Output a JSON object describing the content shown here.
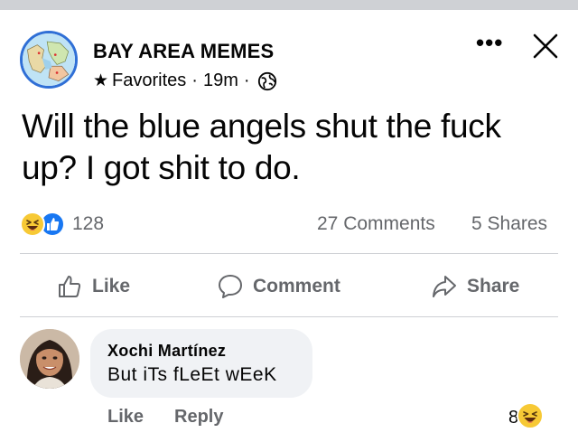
{
  "post": {
    "page_name": "BAY AREA MEMES",
    "audience": "Favorites",
    "separator": "·",
    "time": "19m",
    "text": "Will the blue angels shut the fuck up? I got shit  to do."
  },
  "stats": {
    "reaction_count": "128",
    "comments": "27 Comments",
    "shares": "5 Shares"
  },
  "actions": {
    "like": "Like",
    "comment": "Comment",
    "share": "Share"
  },
  "comment": {
    "author": "Xochi Martínez",
    "text": "But iTs fLeEt wEeK",
    "like_label": "Like",
    "reply_label": "Reply",
    "reaction_count": "8"
  },
  "icons": {
    "more": "more-icon",
    "close": "close-icon",
    "star": "star-icon",
    "globe": "globe-icon",
    "haha": "haha-reaction-icon",
    "like_reaction": "like-reaction-icon",
    "like_action": "thumbs-up-icon",
    "comment_action": "comment-bubble-icon",
    "share_action": "share-arrow-icon"
  },
  "colors": {
    "accent": "#1877f2",
    "secondary_text": "#65676b",
    "bubble": "#f0f2f5",
    "haha": "#f7c935"
  }
}
